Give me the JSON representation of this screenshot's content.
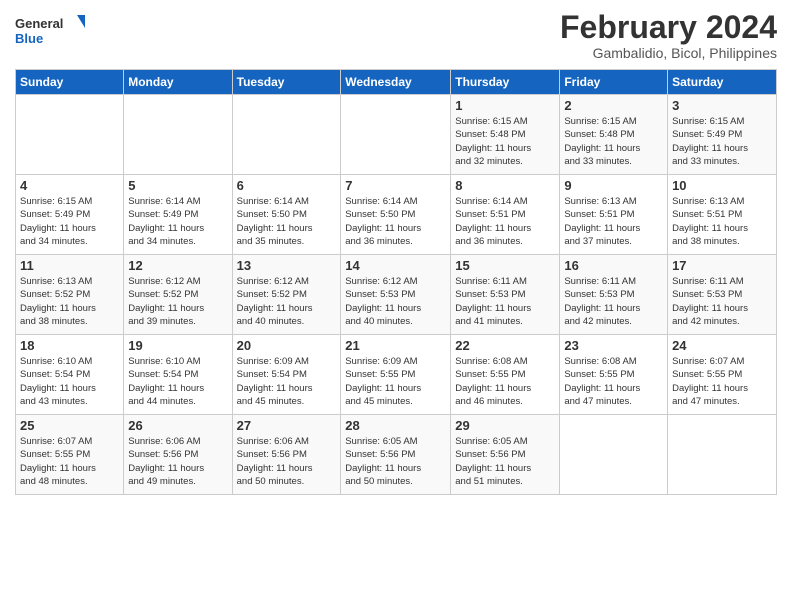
{
  "header": {
    "logo_line1": "General",
    "logo_line2": "Blue",
    "month": "February 2024",
    "location": "Gambalidio, Bicol, Philippines"
  },
  "weekdays": [
    "Sunday",
    "Monday",
    "Tuesday",
    "Wednesday",
    "Thursday",
    "Friday",
    "Saturday"
  ],
  "weeks": [
    [
      {
        "day": "",
        "info": ""
      },
      {
        "day": "",
        "info": ""
      },
      {
        "day": "",
        "info": ""
      },
      {
        "day": "",
        "info": ""
      },
      {
        "day": "1",
        "info": "Sunrise: 6:15 AM\nSunset: 5:48 PM\nDaylight: 11 hours\nand 32 minutes."
      },
      {
        "day": "2",
        "info": "Sunrise: 6:15 AM\nSunset: 5:48 PM\nDaylight: 11 hours\nand 33 minutes."
      },
      {
        "day": "3",
        "info": "Sunrise: 6:15 AM\nSunset: 5:49 PM\nDaylight: 11 hours\nand 33 minutes."
      }
    ],
    [
      {
        "day": "4",
        "info": "Sunrise: 6:15 AM\nSunset: 5:49 PM\nDaylight: 11 hours\nand 34 minutes."
      },
      {
        "day": "5",
        "info": "Sunrise: 6:14 AM\nSunset: 5:49 PM\nDaylight: 11 hours\nand 34 minutes."
      },
      {
        "day": "6",
        "info": "Sunrise: 6:14 AM\nSunset: 5:50 PM\nDaylight: 11 hours\nand 35 minutes."
      },
      {
        "day": "7",
        "info": "Sunrise: 6:14 AM\nSunset: 5:50 PM\nDaylight: 11 hours\nand 36 minutes."
      },
      {
        "day": "8",
        "info": "Sunrise: 6:14 AM\nSunset: 5:51 PM\nDaylight: 11 hours\nand 36 minutes."
      },
      {
        "day": "9",
        "info": "Sunrise: 6:13 AM\nSunset: 5:51 PM\nDaylight: 11 hours\nand 37 minutes."
      },
      {
        "day": "10",
        "info": "Sunrise: 6:13 AM\nSunset: 5:51 PM\nDaylight: 11 hours\nand 38 minutes."
      }
    ],
    [
      {
        "day": "11",
        "info": "Sunrise: 6:13 AM\nSunset: 5:52 PM\nDaylight: 11 hours\nand 38 minutes."
      },
      {
        "day": "12",
        "info": "Sunrise: 6:12 AM\nSunset: 5:52 PM\nDaylight: 11 hours\nand 39 minutes."
      },
      {
        "day": "13",
        "info": "Sunrise: 6:12 AM\nSunset: 5:52 PM\nDaylight: 11 hours\nand 40 minutes."
      },
      {
        "day": "14",
        "info": "Sunrise: 6:12 AM\nSunset: 5:53 PM\nDaylight: 11 hours\nand 40 minutes."
      },
      {
        "day": "15",
        "info": "Sunrise: 6:11 AM\nSunset: 5:53 PM\nDaylight: 11 hours\nand 41 minutes."
      },
      {
        "day": "16",
        "info": "Sunrise: 6:11 AM\nSunset: 5:53 PM\nDaylight: 11 hours\nand 42 minutes."
      },
      {
        "day": "17",
        "info": "Sunrise: 6:11 AM\nSunset: 5:53 PM\nDaylight: 11 hours\nand 42 minutes."
      }
    ],
    [
      {
        "day": "18",
        "info": "Sunrise: 6:10 AM\nSunset: 5:54 PM\nDaylight: 11 hours\nand 43 minutes."
      },
      {
        "day": "19",
        "info": "Sunrise: 6:10 AM\nSunset: 5:54 PM\nDaylight: 11 hours\nand 44 minutes."
      },
      {
        "day": "20",
        "info": "Sunrise: 6:09 AM\nSunset: 5:54 PM\nDaylight: 11 hours\nand 45 minutes."
      },
      {
        "day": "21",
        "info": "Sunrise: 6:09 AM\nSunset: 5:55 PM\nDaylight: 11 hours\nand 45 minutes."
      },
      {
        "day": "22",
        "info": "Sunrise: 6:08 AM\nSunset: 5:55 PM\nDaylight: 11 hours\nand 46 minutes."
      },
      {
        "day": "23",
        "info": "Sunrise: 6:08 AM\nSunset: 5:55 PM\nDaylight: 11 hours\nand 47 minutes."
      },
      {
        "day": "24",
        "info": "Sunrise: 6:07 AM\nSunset: 5:55 PM\nDaylight: 11 hours\nand 47 minutes."
      }
    ],
    [
      {
        "day": "25",
        "info": "Sunrise: 6:07 AM\nSunset: 5:55 PM\nDaylight: 11 hours\nand 48 minutes."
      },
      {
        "day": "26",
        "info": "Sunrise: 6:06 AM\nSunset: 5:56 PM\nDaylight: 11 hours\nand 49 minutes."
      },
      {
        "day": "27",
        "info": "Sunrise: 6:06 AM\nSunset: 5:56 PM\nDaylight: 11 hours\nand 50 minutes."
      },
      {
        "day": "28",
        "info": "Sunrise: 6:05 AM\nSunset: 5:56 PM\nDaylight: 11 hours\nand 50 minutes."
      },
      {
        "day": "29",
        "info": "Sunrise: 6:05 AM\nSunset: 5:56 PM\nDaylight: 11 hours\nand 51 minutes."
      },
      {
        "day": "",
        "info": ""
      },
      {
        "day": "",
        "info": ""
      }
    ]
  ]
}
